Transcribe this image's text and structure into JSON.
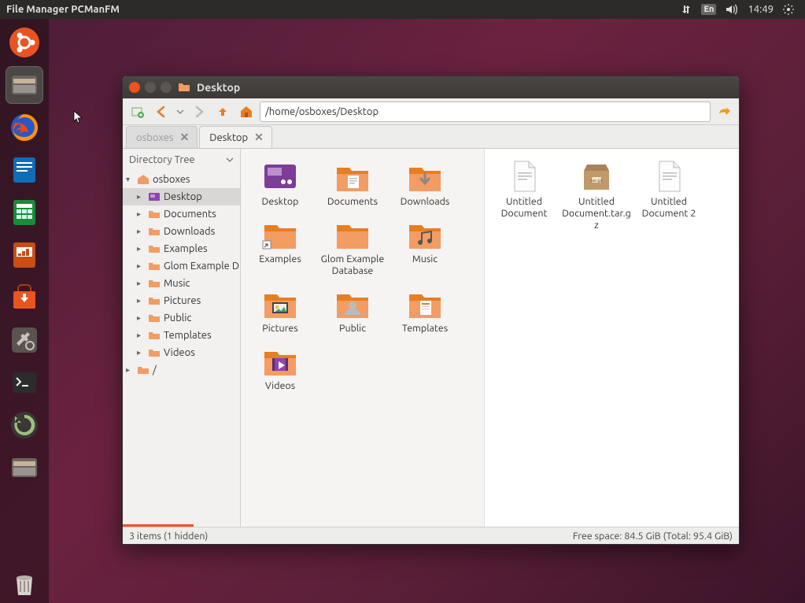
{
  "panel": {
    "app_title": "File Manager PCManFM",
    "lang": "En",
    "time": "14:49"
  },
  "launcher": {
    "items": [
      {
        "name": "dash",
        "icon": "ubuntu"
      },
      {
        "name": "files",
        "icon": "files",
        "active": true
      },
      {
        "name": "firefox",
        "icon": "firefox"
      },
      {
        "name": "writer",
        "icon": "writer"
      },
      {
        "name": "calc",
        "icon": "calc"
      },
      {
        "name": "impress",
        "icon": "impress"
      },
      {
        "name": "software",
        "icon": "software"
      },
      {
        "name": "settings",
        "icon": "settings"
      },
      {
        "name": "terminal",
        "icon": "terminal"
      },
      {
        "name": "updater",
        "icon": "updater"
      },
      {
        "name": "files2",
        "icon": "files"
      }
    ],
    "trash": {
      "name": "trash",
      "icon": "trash"
    }
  },
  "window": {
    "title": "Desktop",
    "path": "/home/osboxes/Desktop",
    "tabs": [
      {
        "label": "osboxes",
        "active": false
      },
      {
        "label": "Desktop",
        "active": true
      }
    ],
    "sidebar": {
      "header": "Directory Tree",
      "tree": [
        {
          "label": "osboxes",
          "level": 1,
          "expanded": true,
          "icon": "home"
        },
        {
          "label": "Desktop",
          "level": 2,
          "selected": true,
          "icon": "desktop"
        },
        {
          "label": "Documents",
          "level": 2,
          "icon": "folder"
        },
        {
          "label": "Downloads",
          "level": 2,
          "icon": "folder"
        },
        {
          "label": "Examples",
          "level": 2,
          "icon": "folder"
        },
        {
          "label": "Glom Example D",
          "level": 2,
          "icon": "folder"
        },
        {
          "label": "Music",
          "level": 2,
          "icon": "folder"
        },
        {
          "label": "Pictures",
          "level": 2,
          "icon": "folder"
        },
        {
          "label": "Public",
          "level": 2,
          "icon": "folder"
        },
        {
          "label": "Templates",
          "level": 2,
          "icon": "folder"
        },
        {
          "label": "Videos",
          "level": 2,
          "icon": "folder"
        },
        {
          "label": "/",
          "level": 1,
          "icon": "folder"
        }
      ]
    },
    "left_items": [
      {
        "label": "Desktop",
        "icon": "desktop"
      },
      {
        "label": "Documents",
        "icon": "folder-docs"
      },
      {
        "label": "Downloads",
        "icon": "folder-down"
      },
      {
        "label": "Examples",
        "icon": "folder-link"
      },
      {
        "label": "Glom Example Database",
        "icon": "folder"
      },
      {
        "label": "Music",
        "icon": "folder-music"
      },
      {
        "label": "Pictures",
        "icon": "folder-pics"
      },
      {
        "label": "Public",
        "icon": "folder-public"
      },
      {
        "label": "Templates",
        "icon": "folder-tmpl"
      },
      {
        "label": "Videos",
        "icon": "folder-video"
      }
    ],
    "right_items": [
      {
        "label": "Untitled Document",
        "icon": "text"
      },
      {
        "label": "Untitled Document.tar.gz",
        "icon": "archive"
      },
      {
        "label": "Untitled Document 2",
        "icon": "text"
      }
    ],
    "status": {
      "left": "3 items (1 hidden)",
      "right": "Free space: 84.5 GiB (Total: 95.4 GiB)"
    }
  }
}
